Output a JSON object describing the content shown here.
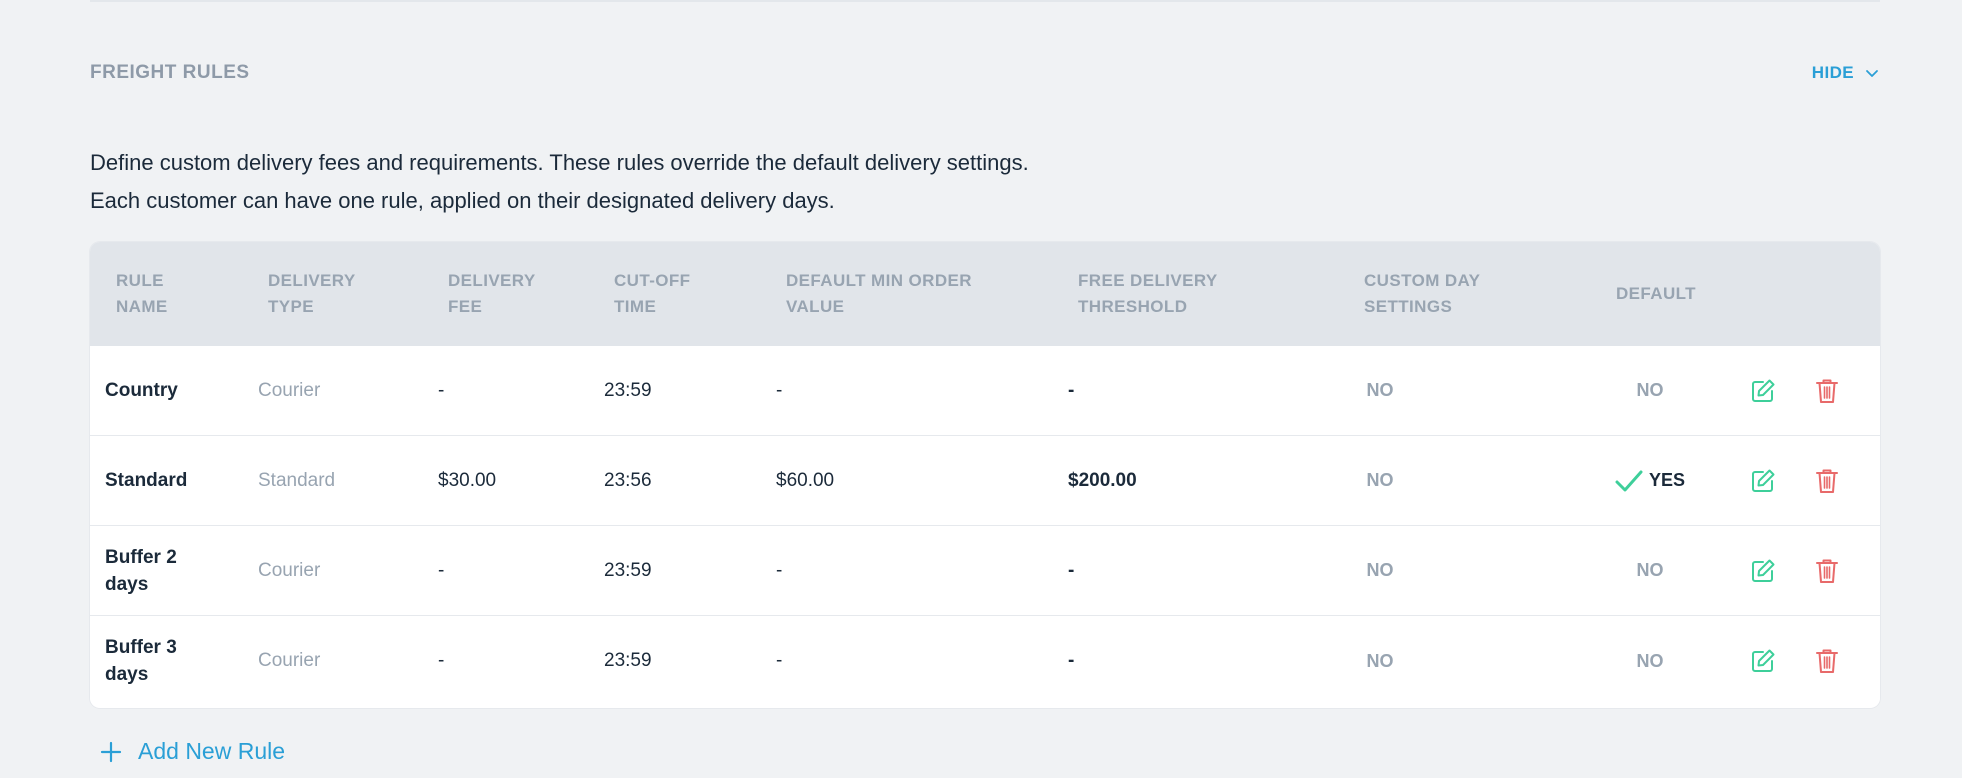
{
  "section": {
    "title": "FREIGHT RULES",
    "toggle_label": "HIDE"
  },
  "description": {
    "line1": "Define custom delivery fees and requirements. These rules override the default delivery settings.",
    "line2": "Each customer can have one rule, applied on their designated delivery days."
  },
  "table": {
    "headers": {
      "rule_name": [
        "RULE",
        "NAME"
      ],
      "delivery_type": [
        "DELIVERY",
        "TYPE"
      ],
      "delivery_fee": [
        "DELIVERY",
        "FEE"
      ],
      "cutoff_time": [
        "CUT-OFF",
        "TIME"
      ],
      "min_order": [
        "DEFAULT MIN ORDER",
        "VALUE"
      ],
      "free_threshold": [
        "FREE DELIVERY",
        "THRESHOLD"
      ],
      "custom_day": [
        "CUSTOM DAY",
        "SETTINGS"
      ],
      "default": [
        "DEFAULT"
      ]
    },
    "rows": [
      {
        "name": "Country",
        "type": "Courier",
        "fee": "-",
        "cutoff": "23:59",
        "min_order": "-",
        "free_threshold": "-",
        "custom_day": "NO",
        "default": "NO",
        "is_default": false
      },
      {
        "name": "Standard",
        "type": "Standard",
        "fee": "$30.00",
        "cutoff": "23:56",
        "min_order": "$60.00",
        "free_threshold": "$200.00",
        "custom_day": "NO",
        "default": "YES",
        "is_default": true
      },
      {
        "name": "Buffer 2 days",
        "type": "Courier",
        "fee": "-",
        "cutoff": "23:59",
        "min_order": "-",
        "free_threshold": "-",
        "custom_day": "NO",
        "default": "NO",
        "is_default": false
      },
      {
        "name": "Buffer 3 days",
        "type": "Courier",
        "fee": "-",
        "cutoff": "23:59",
        "min_order": "-",
        "free_threshold": "-",
        "custom_day": "NO",
        "default": "NO",
        "is_default": false
      }
    ]
  },
  "add_rule_label": "Add New Rule",
  "colors": {
    "accent": "#2a9fd6",
    "edit": "#3ecf9a",
    "delete": "#e86a6a",
    "check": "#3ecf9a"
  },
  "icons": {
    "toggle": "chevron-down-icon",
    "edit": "edit-icon",
    "delete": "trash-icon",
    "default_check": "check-icon",
    "add": "plus-icon"
  }
}
